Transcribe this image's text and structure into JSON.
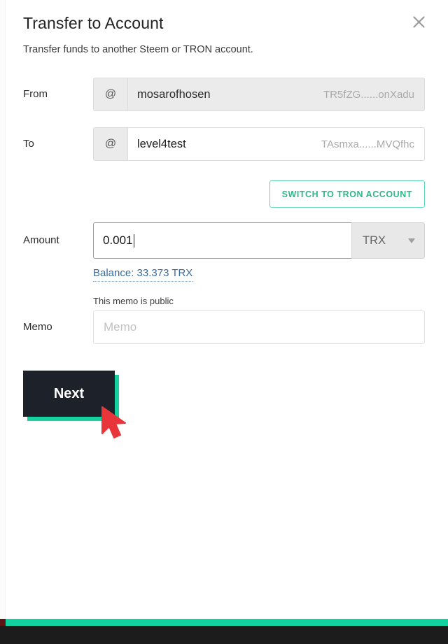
{
  "dialog": {
    "title": "Transfer to Account",
    "subtitle": "Transfer funds to another Steem or TRON account.",
    "close_icon": "close-icon"
  },
  "form": {
    "from": {
      "label": "From",
      "prefix": "@",
      "value": "mosarofhosen",
      "address": "TR5fZG......onXadu"
    },
    "to": {
      "label": "To",
      "prefix": "@",
      "value": "level4test",
      "address": "TAsmxa......MVQfhc"
    },
    "switch_button": {
      "label": "SWITCH TO TRON ACCOUNT"
    },
    "amount": {
      "label": "Amount",
      "value": "0.001",
      "currency": "TRX",
      "balance_link": "Balance: 33.373 TRX"
    },
    "memo": {
      "label": "Memo",
      "hint": "This memo is public",
      "placeholder": "Memo",
      "value": ""
    }
  },
  "actions": {
    "next_label": "Next"
  },
  "colors": {
    "accent_teal": "#13d2a1",
    "button_dark": "#1d222a",
    "link_blue": "#3a6a9a",
    "cursor_red": "#e8353a",
    "switch_border": "#5fd6b2",
    "switch_text": "#2eb88a"
  }
}
